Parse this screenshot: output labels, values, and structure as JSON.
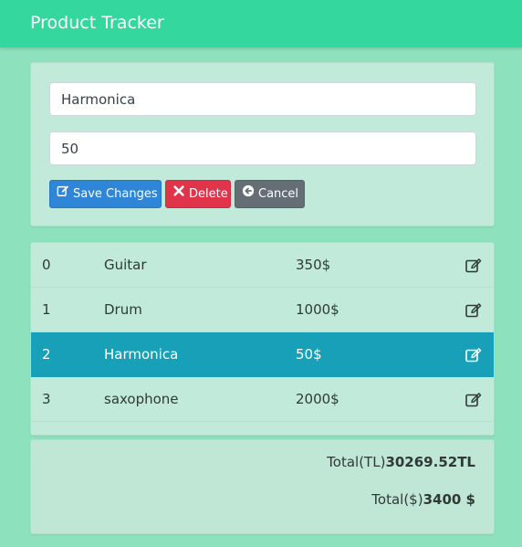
{
  "app": {
    "title": "Product Tracker"
  },
  "form": {
    "name_value": "Harmonica",
    "price_value": "50",
    "save_label": "Save Changes",
    "delete_label": "Delete",
    "cancel_label": "Cancel"
  },
  "products": [
    {
      "id": "0",
      "name": "Guitar",
      "price": "350$"
    },
    {
      "id": "1",
      "name": "Drum",
      "price": "1000$"
    },
    {
      "id": "2",
      "name": "Harmonica",
      "price": "50$",
      "selected": true
    },
    {
      "id": "3",
      "name": "saxophone",
      "price": "2000$"
    }
  ],
  "totals": {
    "tl_label": "Total(TL)",
    "tl_value": "30269.52TL",
    "usd_label": "Total($)",
    "usd_value": "3400 $"
  },
  "icons": {
    "save": "edit-icon",
    "delete": "times-icon",
    "cancel": "arrow-circle-left-icon",
    "row_edit": "edit-icon"
  },
  "colors": {
    "navbar": "#34d89e",
    "background": "#8de2bd",
    "card": "#c1eadb",
    "save": "#2f86d6",
    "delete": "#e0344b",
    "cancel": "#656d75",
    "selected_row": "#17a0b8"
  }
}
